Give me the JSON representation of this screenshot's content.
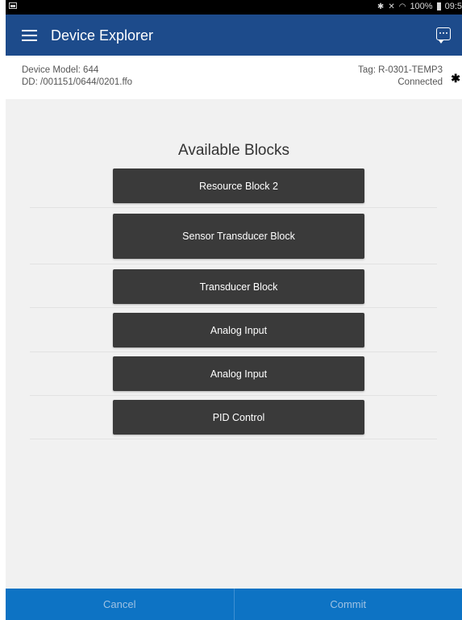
{
  "statusbar": {
    "bluetooth_icon": "bluetooth-icon",
    "mute_icon": "mute-icon",
    "wifi_icon": "wifi-icon",
    "battery": "100%",
    "time": "09:5"
  },
  "appbar": {
    "title": "Device Explorer",
    "menu_icon": "hamburger-menu-icon",
    "chat_icon": "chat-bubble-icon",
    "color": "#1d4b8b"
  },
  "device": {
    "model_label": "Device Model: 644",
    "dd_label": "DD: /001151/0644/0201.ffo",
    "tag_label": "Tag: R-0301-TEMP3",
    "status": "Connected",
    "bt_icon": "bluetooth-icon"
  },
  "blocks": {
    "heading": "Available Blocks",
    "items": [
      {
        "label": "Resource Block 2"
      },
      {
        "label": "Sensor Transducer Block"
      },
      {
        "label": "Transducer Block"
      },
      {
        "label": "Analog Input"
      },
      {
        "label": "Analog Input"
      },
      {
        "label": "PID Control"
      }
    ]
  },
  "footer": {
    "cancel_label": "Cancel",
    "commit_label": "Commit",
    "color": "#0d73c4"
  }
}
